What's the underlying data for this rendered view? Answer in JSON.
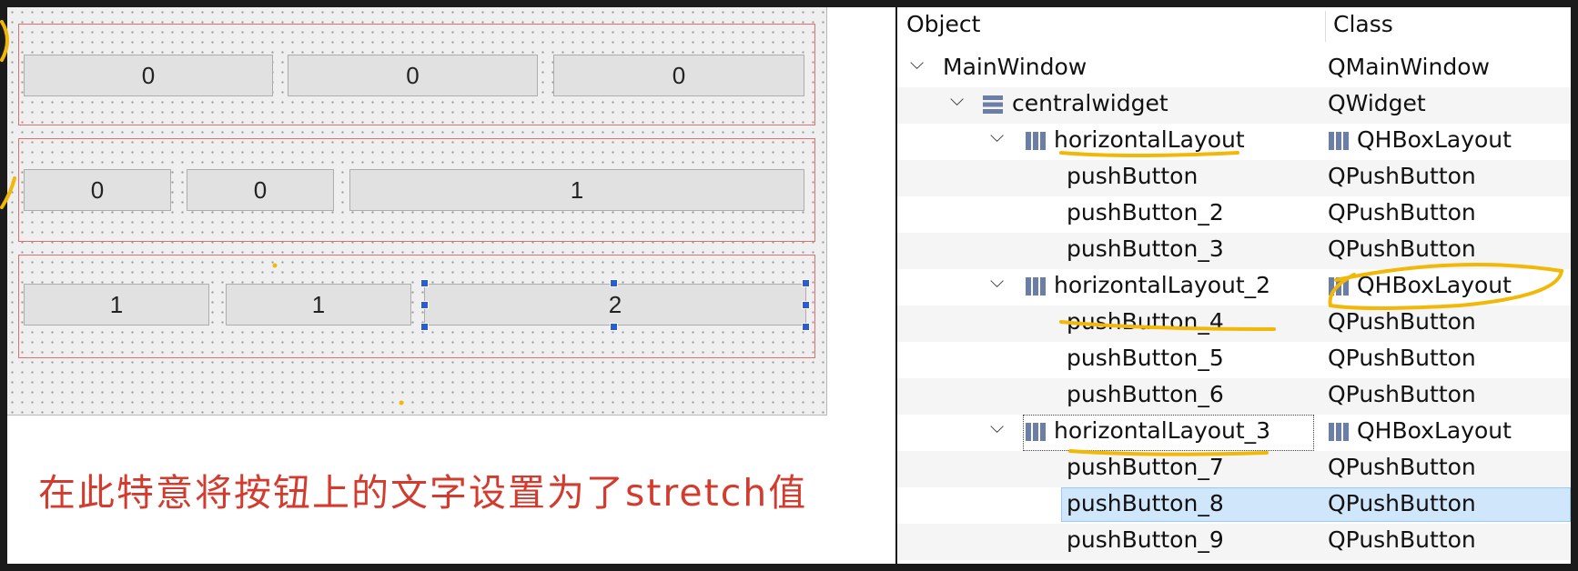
{
  "form": {
    "rows": [
      {
        "buttons": [
          "0",
          "0",
          "0"
        ]
      },
      {
        "buttons": [
          "0",
          "0",
          "1"
        ]
      },
      {
        "buttons": [
          "1",
          "1",
          "2"
        ]
      }
    ]
  },
  "caption": "在此特意将按钮上的文字设置为了stretch值",
  "inspector": {
    "header": {
      "object": "Object",
      "class": "Class"
    },
    "rows": [
      {
        "object": "MainWindow",
        "class": "QMainWindow"
      },
      {
        "object": "centralwidget",
        "class": "QWidget"
      },
      {
        "object": "horizontalLayout",
        "class": "QHBoxLayout"
      },
      {
        "object": "pushButton",
        "class": "QPushButton"
      },
      {
        "object": "pushButton_2",
        "class": "QPushButton"
      },
      {
        "object": "pushButton_3",
        "class": "QPushButton"
      },
      {
        "object": "horizontalLayout_2",
        "class": "QHBoxLayout"
      },
      {
        "object": "pushButton_4",
        "class": "QPushButton"
      },
      {
        "object": "pushButton_5",
        "class": "QPushButton"
      },
      {
        "object": "pushButton_6",
        "class": "QPushButton"
      },
      {
        "object": "horizontalLayout_3",
        "class": "QHBoxLayout"
      },
      {
        "object": "pushButton_7",
        "class": "QPushButton"
      },
      {
        "object": "pushButton_8",
        "class": "QPushButton"
      },
      {
        "object": "pushButton_9",
        "class": "QPushButton"
      }
    ],
    "selected_row": "pushButton_8"
  },
  "colors": {
    "annotation": "#f2b807",
    "layout_border": "#e07070",
    "caption": "#d33b2f",
    "selection": "#cfe6fb"
  }
}
